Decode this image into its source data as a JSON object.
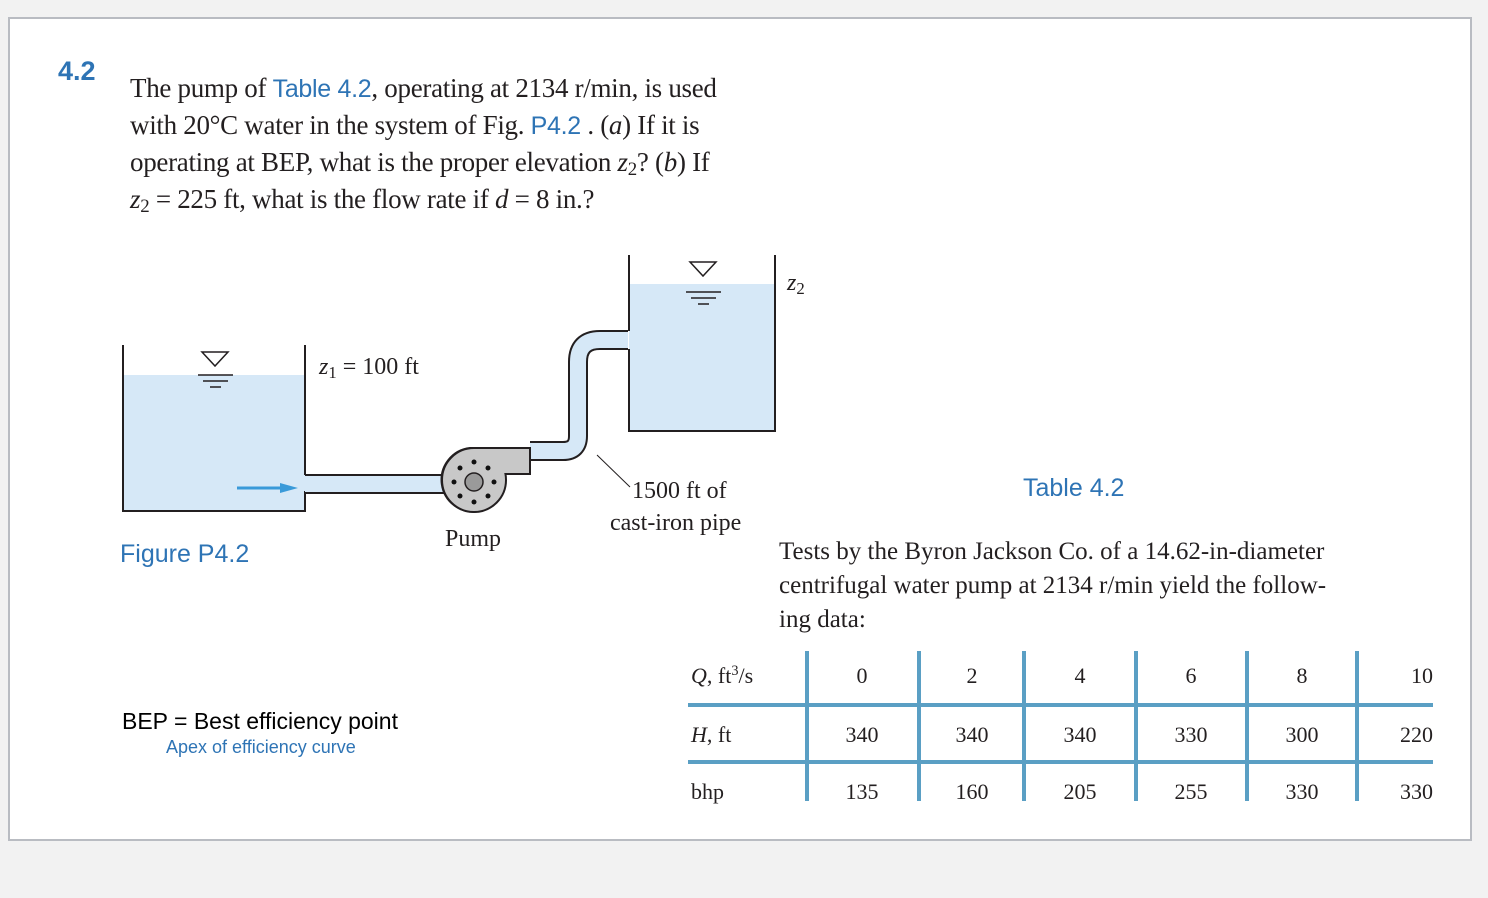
{
  "problem": {
    "number": "4.2",
    "lines": [
      {
        "pre": "The pump of",
        "link": "Table 4.2",
        "post": ", operating at 2134 r/min, is used"
      },
      {
        "pre": "with 20°C water in the system of Fig.",
        "link": "P4.2",
        "post": ". (",
        "italic": "a",
        "post2": ") If it is"
      },
      {
        "pre": "operating at BEP, what is the proper elevation ",
        "var": "z",
        "sub": "2",
        "mid": "? (",
        "italic": "b",
        "post": ") If"
      },
      {
        "var": "z",
        "sub": "2",
        "pre": " = 225 ft, what is the flow rate if ",
        "italic": "d",
        "post": " = 8 in.?"
      }
    ]
  },
  "figure": {
    "caption": "Figure P4.2",
    "z1_var": "z",
    "z1_sub": "1",
    "z1_value": " = 100 ft",
    "z2_var": "z",
    "z2_sub": "2",
    "pump_label": "Pump",
    "pipe_label_line1": "1500 ft of",
    "pipe_label_line2": "cast-iron pipe",
    "colors": {
      "water": "#d6e8f7",
      "pump": "#c8c8c8",
      "arrow": "#3a9ad9",
      "outline": "#231f20"
    }
  },
  "note": {
    "bep_definition": "BEP = Best efficiency point",
    "apex": "Apex of efficiency curve"
  },
  "table": {
    "title": "Table 4.2",
    "description": [
      "Tests by the Byron Jackson Co. of a 14.62-in-diameter",
      "centrifugal water pump at 2134 r/min yield the follow-",
      "ing data:"
    ],
    "rows": [
      {
        "label_var": "Q",
        "label_rest": ", ft",
        "label_sup": "3",
        "label_end": "/s",
        "values": [
          "0",
          "2",
          "4",
          "6",
          "8",
          "10"
        ]
      },
      {
        "label_var": "H",
        "label_rest": ", ft",
        "label_sup": "",
        "label_end": "",
        "values": [
          "340",
          "340",
          "340",
          "330",
          "300",
          "220"
        ]
      },
      {
        "label_var": "",
        "label_rest": "bhp",
        "label_sup": "",
        "label_end": "",
        "values": [
          "135",
          "160",
          "205",
          "255",
          "330",
          "330"
        ]
      }
    ],
    "rule_color": "#5a9fc4"
  }
}
